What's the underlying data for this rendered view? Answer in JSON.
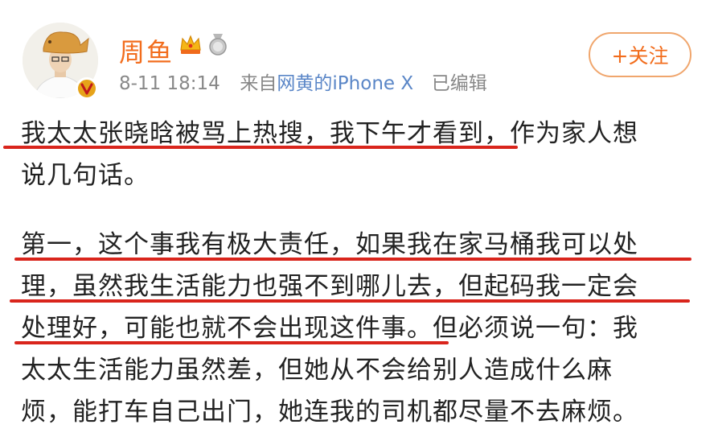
{
  "user": {
    "name": "周鱼",
    "timestamp": "8-11 18:14",
    "source_prefix": "来自",
    "source_device": "网黄的iPhone X",
    "edited": "已编辑"
  },
  "follow_button": {
    "label": "+关注"
  },
  "post": {
    "lines": [
      "我太太张晓晗被骂上热搜，我下午才看到，作为家人想",
      "说几句话。",
      "第一，这个事我有极大责任，如果我在家马桶我可以处",
      "理，虽然我生活能力也强不到哪儿去，但起码我一定会",
      "处理好，可能也就不会出现这件事。但必须说一句：我",
      "太太生活能力虽然差，但她从不会给别人造成什么麻",
      "烦，能打车自己出门，她连我的司机都尽量不去麻烦。"
    ]
  },
  "colors": {
    "name": "#f26d1d",
    "link": "#5a86c7",
    "underline": "#d9251c",
    "meta": "#888888",
    "text": "#222222"
  },
  "icons": [
    "avatar",
    "verified-badge-icon",
    "crown-icon",
    "medal-icon"
  ]
}
